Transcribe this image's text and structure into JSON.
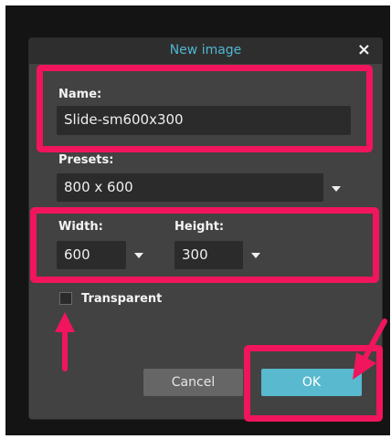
{
  "dialog": {
    "title": "New image",
    "close_glyph": "×",
    "close_icon": "close-icon"
  },
  "name": {
    "label": "Name:",
    "value": "Slide-sm600x300"
  },
  "presets": {
    "label": "Presets:",
    "selected": "800 x 600"
  },
  "width": {
    "label": "Width:",
    "selected": "600"
  },
  "height": {
    "label": "Height:",
    "selected": "300"
  },
  "transparent": {
    "label": "Transparent",
    "checked": false
  },
  "buttons": {
    "cancel": "Cancel",
    "ok": "OK"
  },
  "annotations": {
    "highlight_color": "#f0155c"
  },
  "colors": {
    "title_accent": "#4fb7d1",
    "ok_button": "#59b9cf",
    "dialog_bg": "#424242",
    "input_bg": "#2b2b2b"
  }
}
